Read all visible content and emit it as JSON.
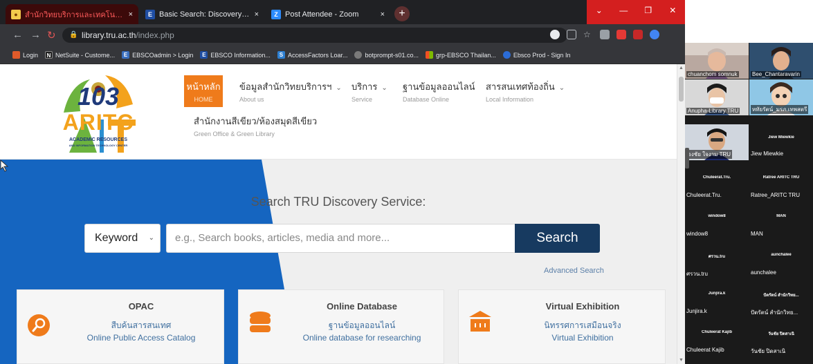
{
  "browser": {
    "tabs": [
      {
        "title": "สำนักวิทยบริการและเทคโนโลยีสารสนเทศ",
        "active": true
      },
      {
        "title": "Basic Search: Discovery Service f...",
        "active": false
      },
      {
        "title": "Post Attendee - Zoom",
        "active": false
      }
    ],
    "close_glyph": "×",
    "new_tab_glyph": "+",
    "window_controls": [
      "⌄",
      "—",
      "❐",
      "✕"
    ],
    "url": {
      "host": "library.tru.ac.th",
      "path": "/index.php"
    },
    "bookmarks": [
      {
        "label": "Login",
        "color": "#e05a2a"
      },
      {
        "label": "NetSuite - Custome...",
        "color": "#1e1e1e"
      },
      {
        "label": "EBSCOadmin > Login",
        "color": "#3a6fbf"
      },
      {
        "label": "EBSCO Information...",
        "color": "#1f4ea3"
      },
      {
        "label": "AccessFactors Loar...",
        "color": "#2d7fd1"
      },
      {
        "label": "botprompt-s01.co...",
        "color": "#7a7a7a"
      },
      {
        "label": "grp-EBSCO Thailan...",
        "color": "#f25022"
      },
      {
        "label": "Ebsco Prod - Sign In",
        "color": "#2b6cd6"
      }
    ]
  },
  "site": {
    "logo": {
      "number": "103",
      "acronym": "ARITC",
      "line1": "ACADEMIC RESOURCES",
      "line2": "AND INFORMATION TECHNOLOGY CENTER"
    },
    "nav": [
      {
        "th": "หน้าหลัก",
        "en": "HOME",
        "active": true
      },
      {
        "th": "ข้อมูลสำนักวิทยบริการฯ",
        "en": "About us",
        "dropdown": true
      },
      {
        "th": "บริการ",
        "en": "Service",
        "dropdown": true
      },
      {
        "th": "ฐานข้อมูลออนไลน์",
        "en": "Database Online",
        "dropdown": false
      },
      {
        "th": "สารสนเทศท้องถิ่น",
        "en": "Local Information",
        "dropdown": true
      },
      {
        "th": "สำนักงานสีเขียว/ห้องสมุดสีเขียว",
        "en": "Green Office & Green Library",
        "dropdown": false
      }
    ],
    "search": {
      "heading": "Search TRU Discovery Service:",
      "keyword_label": "Keyword",
      "placeholder": "e.g., Search books, articles, media and more...",
      "button": "Search",
      "advanced": "Advanced Search"
    },
    "cards": [
      {
        "title": "OPAC",
        "th": "สืบค้นสารสนเทศ",
        "en": "Online Public Access Catalog",
        "icon": "search-icon"
      },
      {
        "title": "Online Database",
        "th": "ฐานข้อมูลออนไลน์",
        "en": "Online database for researching",
        "icon": "database-icon"
      },
      {
        "title": "Virtual Exhibition",
        "th": "นิทรรศการเสมือนจริง",
        "en": "Virtual Exhibition",
        "icon": "museum-icon"
      }
    ]
  },
  "zoom": {
    "participants": [
      {
        "name": "chuanchom somnuk",
        "video": true
      },
      {
        "name": "Bee_Chantaravarin",
        "video": true
      },
      {
        "name": "Anupha-Library TRU",
        "video": true
      },
      {
        "name": "หทัยรัตน์_มรภ.เทพสตรี",
        "video": true
      },
      {
        "name": "ธงชัย ใจงาม TRU",
        "video": true
      },
      {
        "name": "Jiew Miewkie",
        "video": false,
        "small": "Jiew Miewkie"
      },
      {
        "name": "Chuleerat.Tru.",
        "video": false,
        "small": "Chuleerat.Tru."
      },
      {
        "name": "Ratree_ARITC TRU",
        "video": false,
        "small": "Ratree ARITC TRU"
      },
      {
        "name": "window8",
        "video": false,
        "small": "window8"
      },
      {
        "name": "MAN",
        "video": false,
        "small": "MAN"
      },
      {
        "name": "ศรวน.tru",
        "video": false,
        "small": "ศรวน.tru"
      },
      {
        "name": "aunchalee",
        "video": false,
        "small": "aunchalee"
      },
      {
        "name": "Junjira.k",
        "video": false,
        "small": "Junjira.k"
      },
      {
        "name": "ปัตรัตน์ สำนักวิทย...",
        "video": false,
        "small": "ปัตรัตน์ สำนักวิทย..."
      },
      {
        "name": "Chuleerat Kajib",
        "video": false,
        "small": "Chuleerat Kajib"
      },
      {
        "name": "วันชัย ปิดสาเนิ",
        "video": false,
        "small": "วันชัย ปิดสาเนิ"
      }
    ]
  },
  "colors": {
    "accent_orange": "#ef7b1b",
    "search_navy": "#173a60",
    "hero_blue": "#1565c0",
    "link_blue": "#3f6f9f",
    "zoom_bg": "#1a1a1a"
  }
}
